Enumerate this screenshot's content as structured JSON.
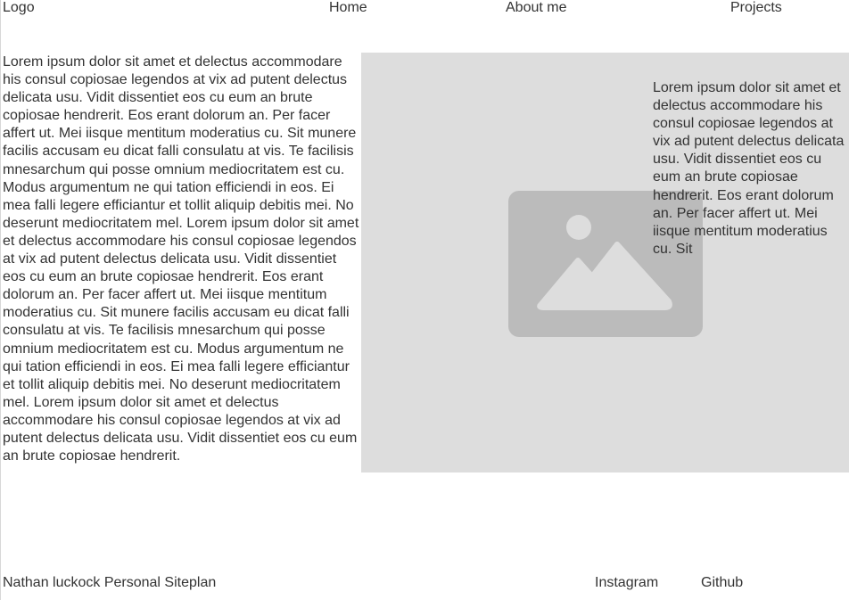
{
  "header": {
    "logo": "Logo",
    "nav": {
      "home": "Home",
      "about": "About me",
      "projects": "Projects"
    }
  },
  "main": {
    "body_text": "Lorem ipsum dolor sit amet et delectus accommodare his consul copiosae legendos at vix ad putent delectus delicata usu. Vidit dissentiet eos cu eum an brute copiosae hendrerit. Eos erant dolorum an. Per facer affert ut. Mei iisque mentitum moderatius cu. Sit munere facilis accusam eu dicat falli consulatu at vis. Te facilisis mnesarchum qui posse omnium mediocritatem est cu. Modus argumentum ne qui tation efficiendi in eos. Ei mea falli legere efficiantur et tollit aliquip debitis mei. No deserunt mediocritatem mel. Lorem ipsum dolor sit amet et delectus accommodare his consul copiosae legendos at vix ad putent delectus delicata usu. Vidit dissentiet eos cu eum an brute copiosae hendrerit. Eos erant dolorum an. Per facer affert ut. Mei iisque mentitum moderatius cu. Sit munere facilis accusam eu dicat falli consulatu at vis. Te facilisis mnesarchum qui posse omnium mediocritatem est cu. Modus argumentum ne qui tation efficiendi in eos. Ei mea falli legere efficiantur et tollit aliquip debitis mei. No deserunt mediocritatem mel. Lorem ipsum dolor sit amet et delectus accommodare his consul copiosae legendos at vix ad putent delectus delicata usu. Vidit dissentiet eos cu eum an brute copiosae hendrerit.",
    "image_icon": "image-placeholder-icon",
    "side_text": "Lorem ipsum dolor sit amet et delectus accommodare his consul copiosae legendos at vix ad putent delectus delicata usu. Vidit dissentiet eos cu eum an brute copiosae hendrerit. Eos erant dolorum an. Per facer affert ut. Mei iisque mentitum moderatius cu. Sit"
  },
  "footer": {
    "title": "Nathan luckock Personal Siteplan",
    "instagram": "Instagram",
    "github": "Github"
  },
  "colors": {
    "panel": "#dddddd",
    "icon": "#bbbbbb",
    "icon_glyph": "#dddddd",
    "text": "#333333"
  }
}
